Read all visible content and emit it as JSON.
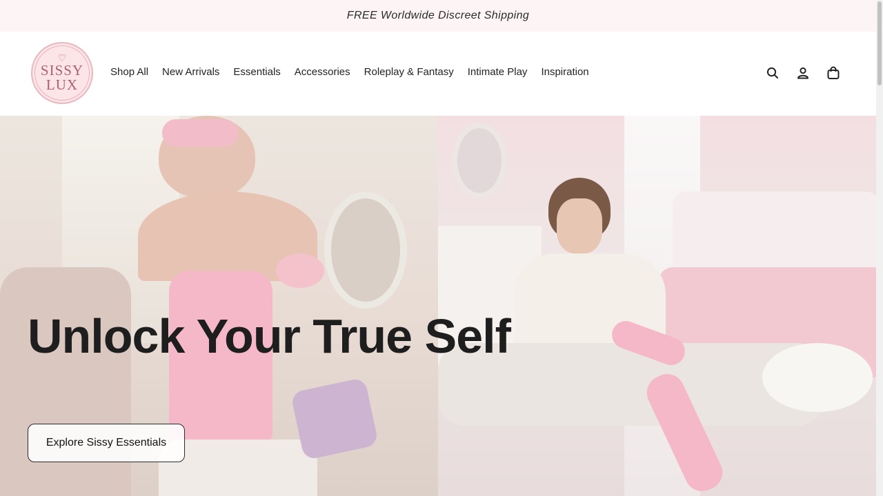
{
  "announcement": {
    "text": "FREE Worldwide Discreet Shipping"
  },
  "brand": {
    "logo_line1": "SISSY",
    "logo_line2": "LUX"
  },
  "nav": {
    "items": [
      {
        "label": "Shop All"
      },
      {
        "label": "New Arrivals"
      },
      {
        "label": "Essentials"
      },
      {
        "label": "Accessories"
      },
      {
        "label": "Roleplay & Fantasy"
      },
      {
        "label": "Intimate Play"
      },
      {
        "label": "Inspiration"
      }
    ]
  },
  "header_icons": [
    "search-icon",
    "account-icon",
    "cart-icon"
  ],
  "hero": {
    "title": "Unlock Your True Self",
    "cta_label": "Explore Sissy Essentials"
  },
  "colors": {
    "announcement_bg": "#fdf5f5",
    "logo_pink": "#fbe5e8",
    "hero_pink": "#f4b8c8"
  }
}
